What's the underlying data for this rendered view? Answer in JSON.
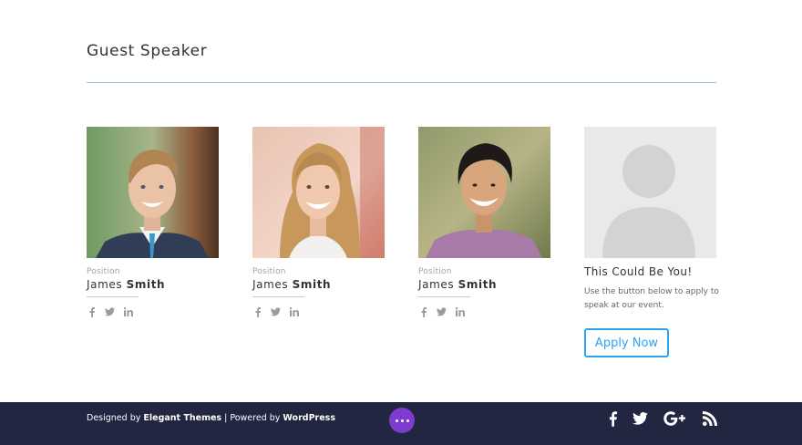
{
  "section": {
    "title": "Guest Speaker"
  },
  "speakers": [
    {
      "position_label": "Position",
      "first_name": "James",
      "last_name": "Smith"
    },
    {
      "position_label": "Position",
      "first_name": "James",
      "last_name": "Smith"
    },
    {
      "position_label": "Position",
      "first_name": "James",
      "last_name": "Smith"
    }
  ],
  "card_socials": [
    "facebook-icon",
    "twitter-icon",
    "linkedin-icon"
  ],
  "cta": {
    "title": "This Could Be You!",
    "text": "Use the button below to apply to speak at our event.",
    "button_label": "Apply Now"
  },
  "footer": {
    "designed_by_prefix": "Designed by",
    "designed_by_link": "Elegant Themes",
    "separator": " | Powered by ",
    "powered_by_link": "WordPress",
    "socials": [
      "facebook-icon",
      "twitter-icon",
      "google-plus-icon",
      "rss-icon"
    ]
  },
  "colors": {
    "accent": "#2ea3f2",
    "divider": "#9cc5d9",
    "footer_bg": "#222641",
    "menu_button": "#7e3bd0"
  }
}
